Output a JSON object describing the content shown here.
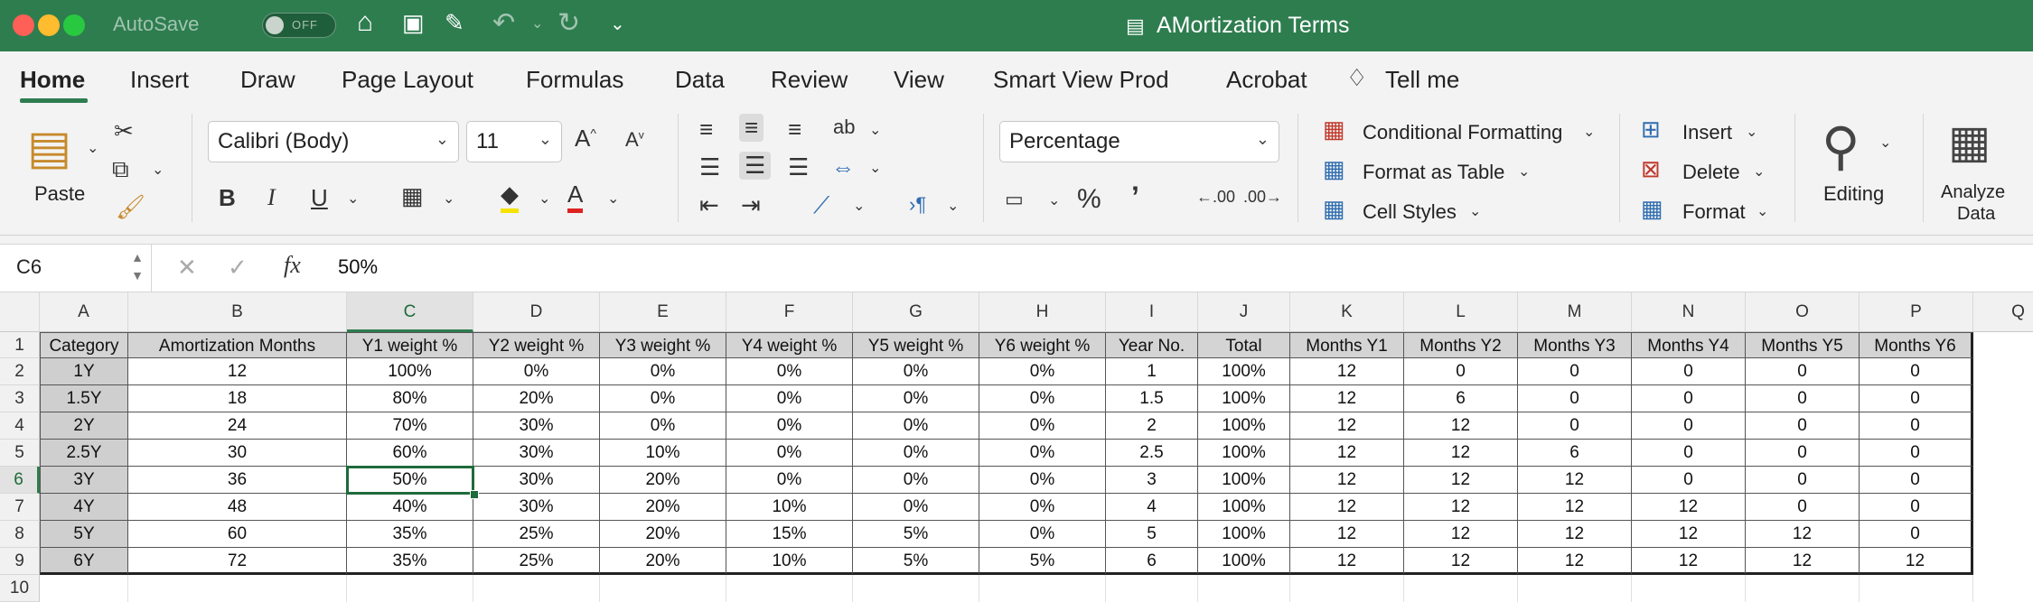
{
  "titlebar": {
    "autosave_label": "AutoSave",
    "autosave_state": "OFF",
    "document_title": "AMortization Terms"
  },
  "tabs": [
    "Home",
    "Insert",
    "Draw",
    "Page Layout",
    "Formulas",
    "Data",
    "Review",
    "View",
    "Smart View Prod",
    "Acrobat",
    "Tell me"
  ],
  "ribbon": {
    "paste_label": "Paste",
    "font_name": "Calibri (Body)",
    "font_size": "11",
    "number_format": "Percentage",
    "conditional_formatting": "Conditional Formatting",
    "format_as_table": "Format as Table",
    "cell_styles": "Cell Styles",
    "insert": "Insert",
    "delete": "Delete",
    "format": "Format",
    "editing": "Editing",
    "analyze_data_line1": "Analyze",
    "analyze_data_line2": "Data",
    "percent_symbol": "%",
    "comma_symbol": "’",
    "inc_decimal": ".00",
    "dec_decimal": ".00"
  },
  "formula_bar": {
    "name_box": "C6",
    "fx": "fx",
    "value": "50%"
  },
  "sheet": {
    "columns": [
      "A",
      "B",
      "C",
      "D",
      "E",
      "F",
      "G",
      "H",
      "I",
      "J",
      "K",
      "L",
      "M",
      "N",
      "O",
      "P",
      "Q"
    ],
    "row_numbers": [
      "1",
      "2",
      "3",
      "4",
      "5",
      "6",
      "7",
      "8",
      "9",
      "10"
    ],
    "selected_cell": "C6",
    "headers": [
      "Category",
      "Amortization Months",
      "Y1 weight %",
      "Y2 weight %",
      "Y3 weight %",
      "Y4 weight %",
      "Y5 weight %",
      "Y6 weight %",
      "Year No.",
      "Total",
      "Months Y1",
      "Months Y2",
      "Months Y3",
      "Months Y4",
      "Months Y5",
      "Months Y6"
    ],
    "rows": [
      [
        "1Y",
        "12",
        "100%",
        "0%",
        "0%",
        "0%",
        "0%",
        "0%",
        "1",
        "100%",
        "12",
        "0",
        "0",
        "0",
        "0",
        "0"
      ],
      [
        "1.5Y",
        "18",
        "80%",
        "20%",
        "0%",
        "0%",
        "0%",
        "0%",
        "1.5",
        "100%",
        "12",
        "6",
        "0",
        "0",
        "0",
        "0"
      ],
      [
        "2Y",
        "24",
        "70%",
        "30%",
        "0%",
        "0%",
        "0%",
        "0%",
        "2",
        "100%",
        "12",
        "12",
        "0",
        "0",
        "0",
        "0"
      ],
      [
        "2.5Y",
        "30",
        "60%",
        "30%",
        "10%",
        "0%",
        "0%",
        "0%",
        "2.5",
        "100%",
        "12",
        "12",
        "6",
        "0",
        "0",
        "0"
      ],
      [
        "3Y",
        "36",
        "50%",
        "30%",
        "20%",
        "0%",
        "0%",
        "0%",
        "3",
        "100%",
        "12",
        "12",
        "12",
        "0",
        "0",
        "0"
      ],
      [
        "4Y",
        "48",
        "40%",
        "30%",
        "20%",
        "10%",
        "0%",
        "0%",
        "4",
        "100%",
        "12",
        "12",
        "12",
        "12",
        "0",
        "0"
      ],
      [
        "5Y",
        "60",
        "35%",
        "25%",
        "20%",
        "15%",
        "5%",
        "0%",
        "5",
        "100%",
        "12",
        "12",
        "12",
        "12",
        "12",
        "0"
      ],
      [
        "6Y",
        "72",
        "35%",
        "25%",
        "20%",
        "10%",
        "5%",
        "5%",
        "6",
        "100%",
        "12",
        "12",
        "12",
        "12",
        "12",
        "12"
      ]
    ]
  },
  "colors": {
    "title_bar": "#2e7d4f",
    "accent": "#1e6b3b",
    "close": "#fe5f57",
    "minimize": "#febc2e",
    "zoom": "#28c840"
  }
}
